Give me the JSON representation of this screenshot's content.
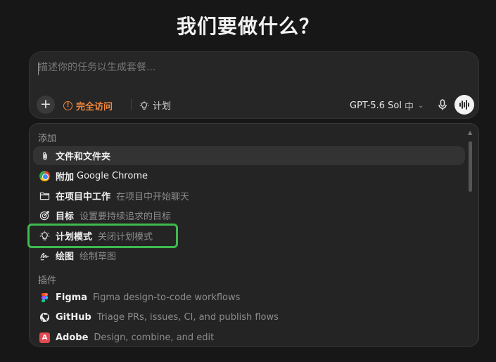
{
  "heading": "我们要做什么？",
  "composer": {
    "placeholder": "描述你的任务以生成套餐...",
    "add_icon": "plus-icon",
    "access_label": "完全访问",
    "access_icon": "alert-circle-icon",
    "plan_label": "计划",
    "plan_icon": "lightbulb-icon",
    "model": "GPT-5.6 Sol",
    "effort": "中",
    "mic_icon": "microphone-icon",
    "voice_icon": "voice-wave-icon",
    "accent_color": "#f2873c"
  },
  "menu": {
    "groups": [
      {
        "label": "添加",
        "items": [
          {
            "icon": "paperclip-icon",
            "label": "文件和文件夹",
            "desc": ""
          },
          {
            "icon": "chrome-icon",
            "label": "附加",
            "label_suffix": "Google Chrome",
            "desc": ""
          },
          {
            "icon": "folder-icon",
            "label": "在项目中工作",
            "desc": "在项目中开始聊天"
          },
          {
            "icon": "target-icon",
            "label": "目标",
            "desc": "设置要持续追求的目标"
          },
          {
            "icon": "lightbulb-icon",
            "label": "计划模式",
            "desc": "关闭计划模式"
          },
          {
            "icon": "draw-icon",
            "label": "绘图",
            "desc": "绘制草图"
          }
        ]
      },
      {
        "label": "插件",
        "items": [
          {
            "icon": "figma-icon",
            "label": "Figma",
            "desc": "Figma design-to-code workflows"
          },
          {
            "icon": "github-icon",
            "label": "GitHub",
            "desc": "Triage PRs, issues, CI, and publish flows"
          },
          {
            "icon": "adobe-icon",
            "label": "Adobe",
            "desc": "Design, combine, and edit"
          }
        ]
      }
    ]
  },
  "highlight_color": "#3fb950"
}
